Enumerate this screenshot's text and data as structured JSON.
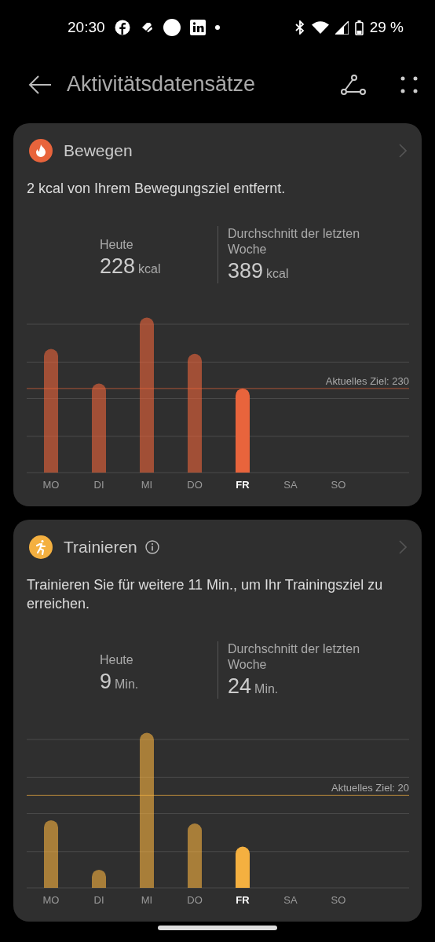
{
  "status_bar": {
    "time": "20:30",
    "battery": "29 %"
  },
  "app_bar": {
    "title": "Aktivitätsdatensätze"
  },
  "cards": [
    {
      "kind": "move",
      "title": "Bewegen",
      "info": false,
      "color": "#e8643c",
      "message": "2 kcal von Ihrem Bewegungsziel entfernt.",
      "today_label": "Heute",
      "today_value": "228",
      "today_unit": "kcal",
      "avg_label": "Durchschnitt der letzten Woche",
      "avg_value": "389",
      "avg_unit": "kcal",
      "goal_label": "Aktuelles Ziel: 230",
      "days": [
        {
          "label": "MO",
          "selected": false
        },
        {
          "label": "DI",
          "selected": false
        },
        {
          "label": "MI",
          "selected": false
        },
        {
          "label": "DO",
          "selected": false
        },
        {
          "label": "FR",
          "selected": true
        },
        {
          "label": "SA",
          "selected": false
        },
        {
          "label": "SO",
          "selected": false
        }
      ]
    },
    {
      "kind": "exercise",
      "title": "Trainieren",
      "info": true,
      "color": "#f4b040",
      "message": "Trainieren Sie für weitere 11 Min., um Ihr Trainingsziel zu erreichen.",
      "today_label": "Heute",
      "today_value": "9",
      "today_unit": "Min.",
      "avg_label": "Durchschnitt der letzten Woche",
      "avg_value": "24",
      "avg_unit": "Min.",
      "goal_label": "Aktuelles Ziel: 20",
      "days": [
        {
          "label": "MO",
          "selected": false
        },
        {
          "label": "DI",
          "selected": false
        },
        {
          "label": "MI",
          "selected": false
        },
        {
          "label": "DO",
          "selected": false
        },
        {
          "label": "FR",
          "selected": true
        },
        {
          "label": "SA",
          "selected": false
        },
        {
          "label": "SO",
          "selected": false
        }
      ]
    }
  ]
}
